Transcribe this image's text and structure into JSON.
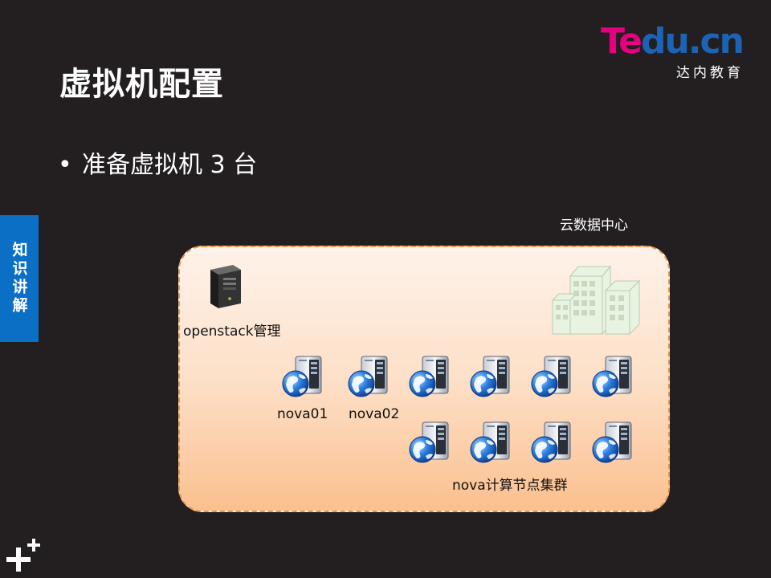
{
  "slide": {
    "title": "虚拟机配置",
    "bullet_symbol": "•",
    "bullet_text": "准备虚拟机 3 台",
    "side_tab_label": "知识讲解"
  },
  "logo": {
    "main_part1": "Te",
    "main_part2": "du.cn",
    "sub": "达内教育"
  },
  "diagram": {
    "datacenter_label": "云数据中心",
    "management_label": "openstack管理",
    "node_labels": [
      "nova01",
      "nova02"
    ],
    "cluster_label": "nova计算节点集群"
  },
  "icons": {
    "server": "server-globe-icon",
    "tower": "tower-server-icon",
    "building": "building-icon",
    "plus": "plus-mark-icon"
  }
}
